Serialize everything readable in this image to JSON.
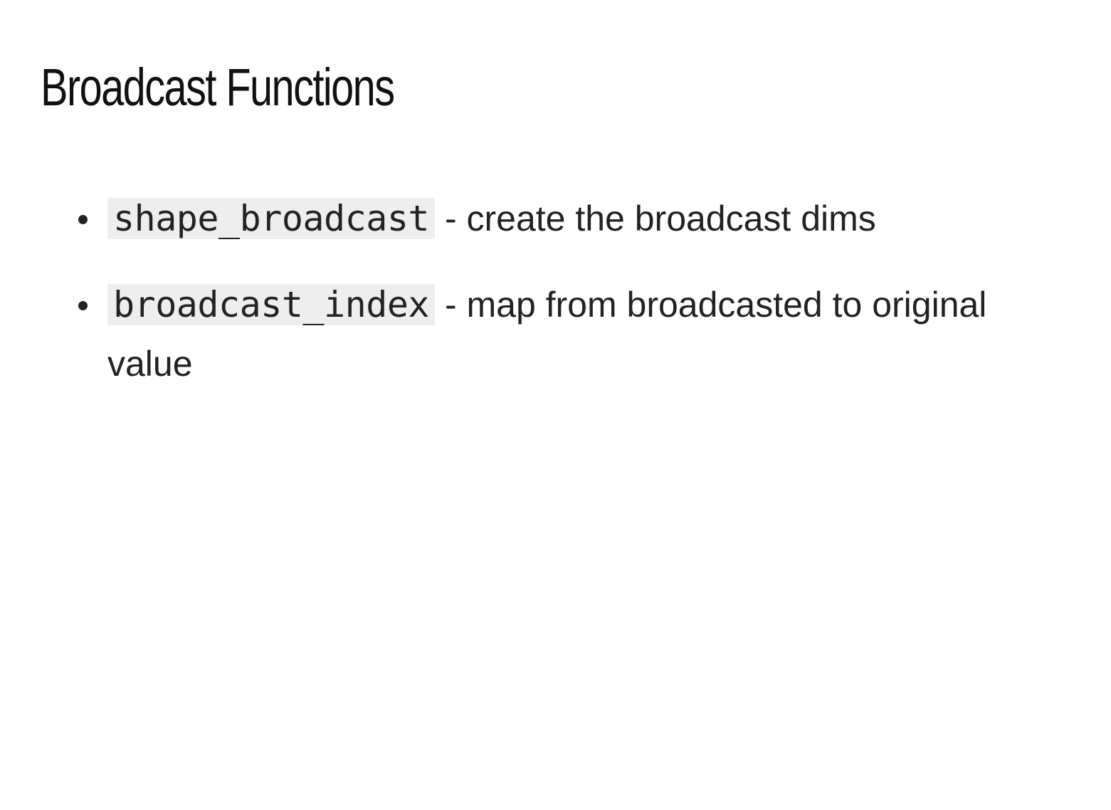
{
  "slide": {
    "title": "Broadcast Functions",
    "bullets": [
      {
        "code": "shape_broadcast",
        "text": " - create the broadcast dims"
      },
      {
        "code": "broadcast_index",
        "text": " - map from broadcasted to original value"
      }
    ]
  },
  "colors": {
    "background": "#ffffff",
    "text": "#222222",
    "code_background": "#eeeeee"
  }
}
